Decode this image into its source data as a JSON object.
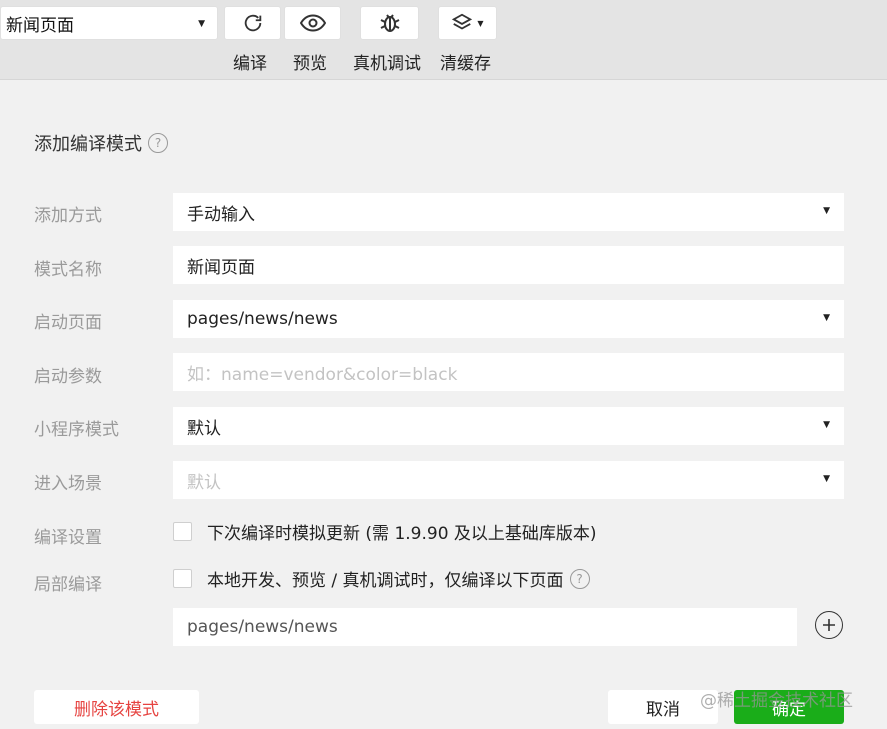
{
  "toolbar": {
    "mode_select_value": "新闻页面",
    "compile_label": "编译",
    "preview_label": "预览",
    "remote_debug_label": "真机调试",
    "clear_cache_label": "清缓存"
  },
  "form": {
    "title": "添加编译模式",
    "add_method": {
      "label": "添加方式",
      "value": "手动输入"
    },
    "mode_name": {
      "label": "模式名称",
      "value": "新闻页面"
    },
    "launch_page": {
      "label": "启动页面",
      "value": "pages/news/news"
    },
    "launch_params": {
      "label": "启动参数",
      "placeholder": "如：name=vendor&color=black"
    },
    "miniprogram_mode": {
      "label": "小程序模式",
      "value": "默认"
    },
    "scene": {
      "label": "进入场景",
      "placeholder": "默认"
    },
    "compile_settings": {
      "label": "编译设置",
      "checkbox_text": "下次编译时模拟更新 (需 1.9.90 及以上基础库版本)",
      "checked": false
    },
    "partial_compile": {
      "label": "局部编译",
      "checkbox_text": "本地开发、预览 / 真机调试时，仅编译以下页面",
      "checked": false
    },
    "partial_page": "pages/news/news"
  },
  "buttons": {
    "delete": "删除该模式",
    "cancel": "取消",
    "ok": "确定"
  },
  "watermark": "@稀土掘金技术社区",
  "colors": {
    "primary": "#1aad19",
    "danger": "#e64340",
    "toolbar_bg": "#e4e4e4",
    "page_bg": "#f1f1f1"
  }
}
